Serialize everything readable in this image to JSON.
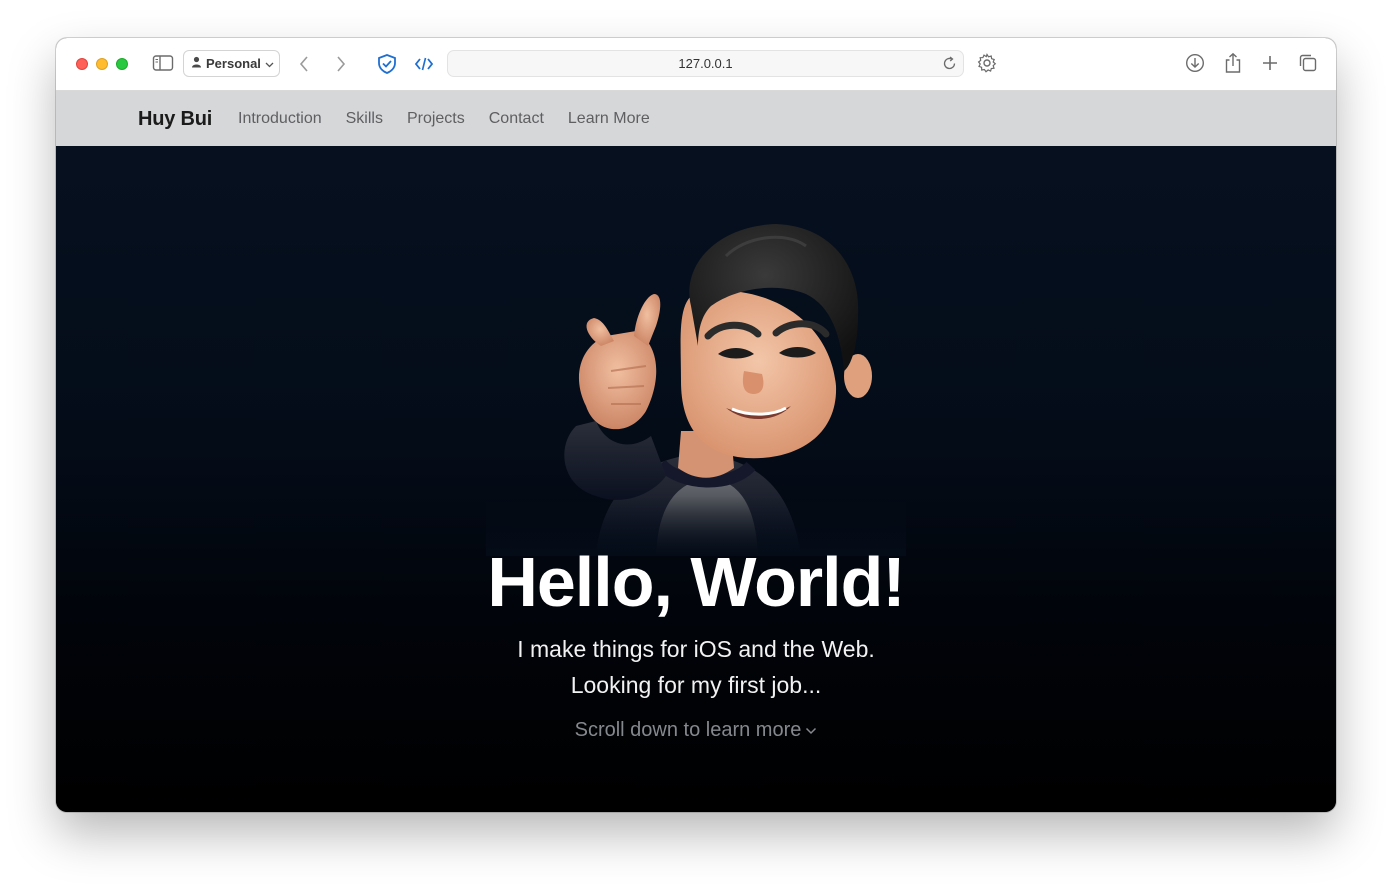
{
  "browser": {
    "profile_label": "Personal",
    "url": "127.0.0.1",
    "icons": [
      "sidebar-icon",
      "person-icon",
      "chevron-down-icon",
      "back-icon",
      "forward-icon",
      "shield-icon",
      "code-icon",
      "reload-icon",
      "gear-icon",
      "download-icon",
      "share-icon",
      "plus-icon",
      "tabs-icon"
    ]
  },
  "site": {
    "brand": "Huy Bui",
    "nav": [
      "Introduction",
      "Skills",
      "Projects",
      "Contact",
      "Learn More"
    ]
  },
  "hero": {
    "title": "Hello, World!",
    "subtitle_line1": "I make things for iOS and the Web.",
    "subtitle_line2": "Looking for my first job...",
    "scroll_hint": "Scroll down to learn more"
  },
  "colors": {
    "nav_background": "#d6d7d9",
    "hero_background": "#040c18",
    "accent_blue": "#1f6fd1"
  }
}
